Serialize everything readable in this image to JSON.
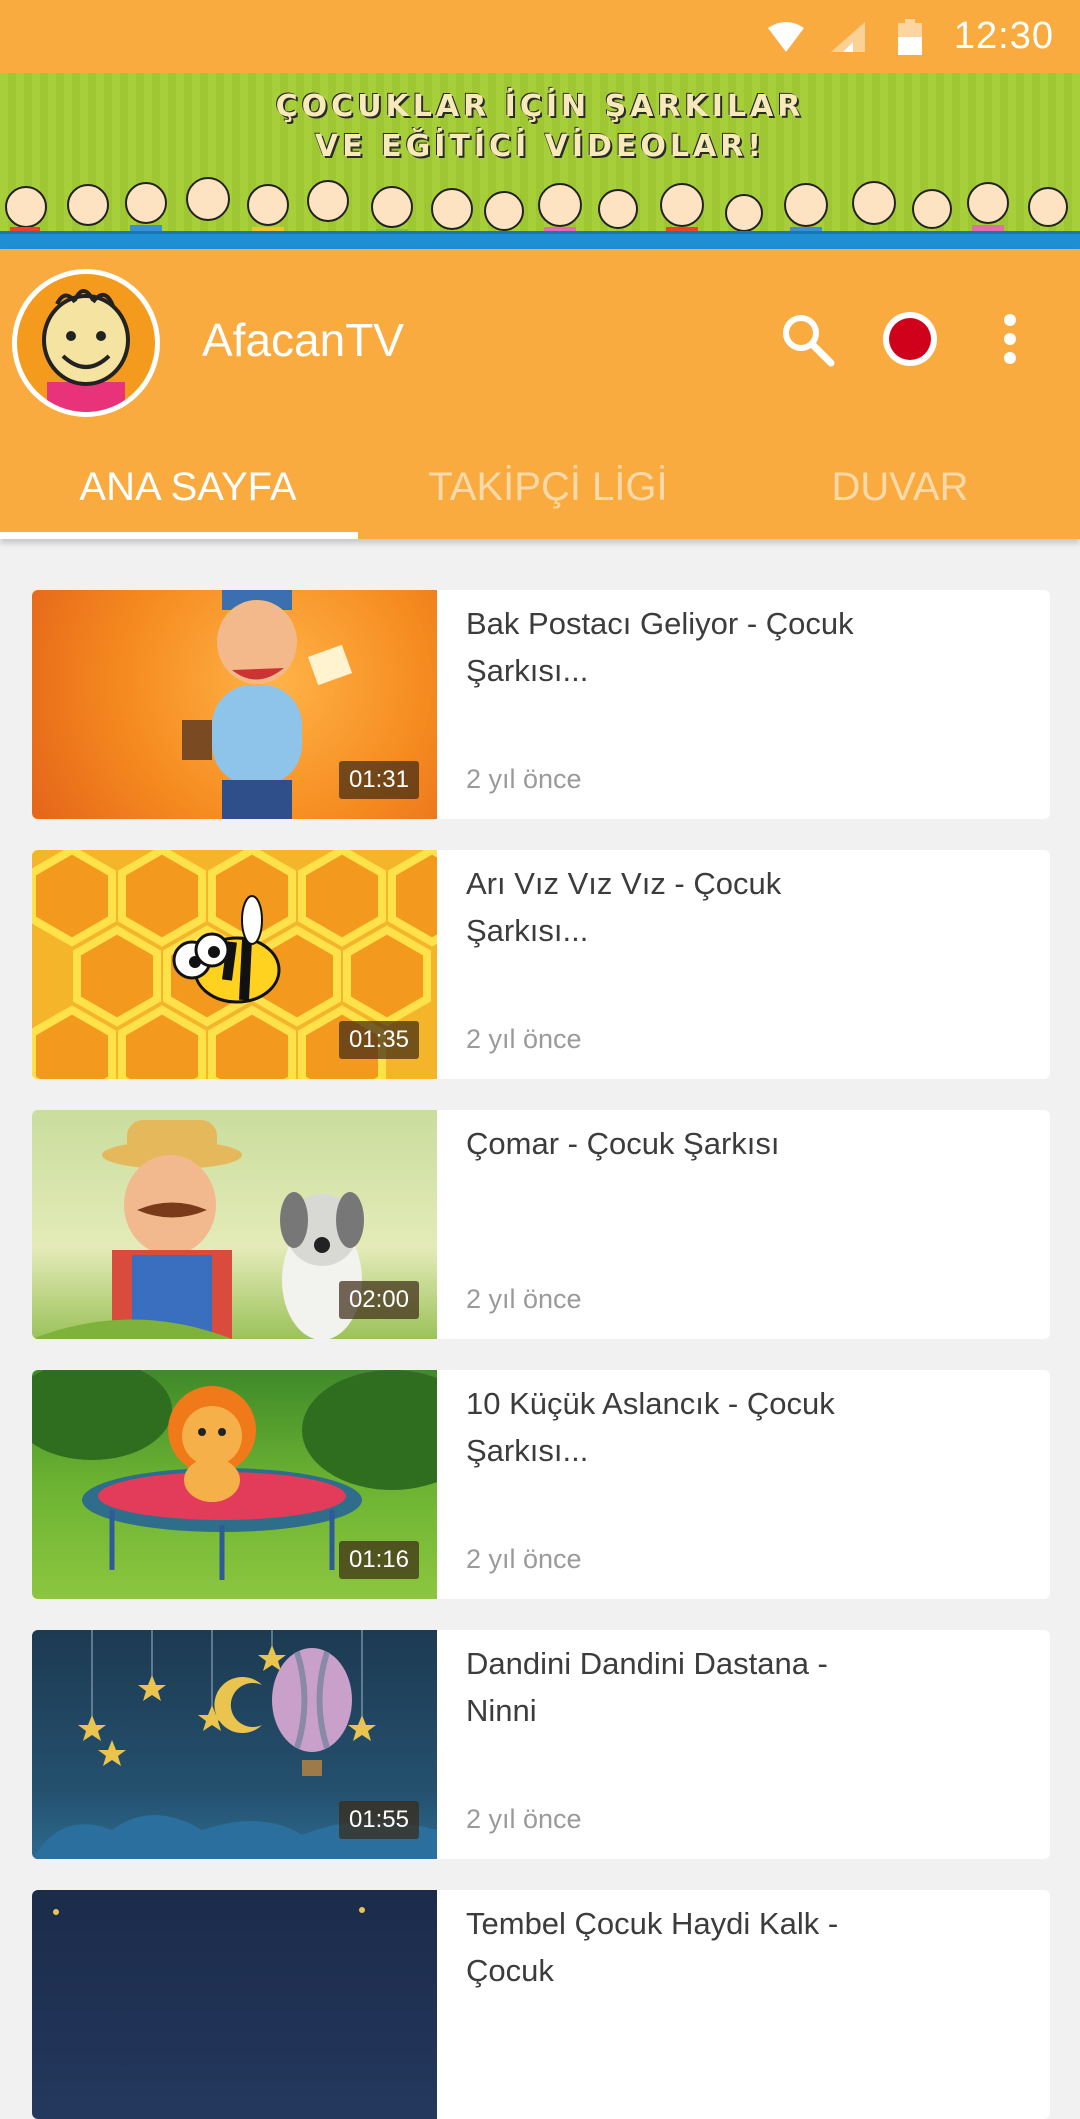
{
  "status_bar": {
    "time": "12:30",
    "icons": [
      "wifi-icon",
      "signal-icon",
      "battery-icon"
    ]
  },
  "banner": {
    "line1": "ÇOCUKLAR İÇİN ŞARKILAR",
    "line2": "VE EĞİTİCİ VİDEOLAR!"
  },
  "header": {
    "title": "AfacanTV",
    "actions": [
      "search-icon",
      "record-icon",
      "more-vert-icon"
    ]
  },
  "tabs": [
    {
      "label": "ANA SAYFA",
      "active": true
    },
    {
      "label": "TAKİPÇİ LİGİ",
      "active": false
    },
    {
      "label": "DUVAR",
      "active": false
    }
  ],
  "videos": [
    {
      "title": "Bak Postacı Geliyor - Çocuk Şarkısı...",
      "age": "2 yıl önce",
      "duration": "01:31"
    },
    {
      "title": "Arı Vız Vız Vız - Çocuk Şarkısı...",
      "age": "2 yıl önce",
      "duration": "01:35"
    },
    {
      "title": "Çomar - Çocuk Şarkısı",
      "age": "2 yıl önce",
      "duration": "02:00"
    },
    {
      "title": "10 Küçük Aslancık - Çocuk Şarkısı...",
      "age": "2 yıl önce",
      "duration": "01:16"
    },
    {
      "title": "Dandini Dandini Dastana - Ninni",
      "age": "2 yıl önce",
      "duration": "01:55"
    },
    {
      "title": "Tembel Çocuk Haydi Kalk - Çocuk",
      "age": "",
      "duration": ""
    }
  ],
  "colors": {
    "accent": "#f9ab40",
    "record": "#d0021b",
    "background": "#f1f1f1"
  }
}
